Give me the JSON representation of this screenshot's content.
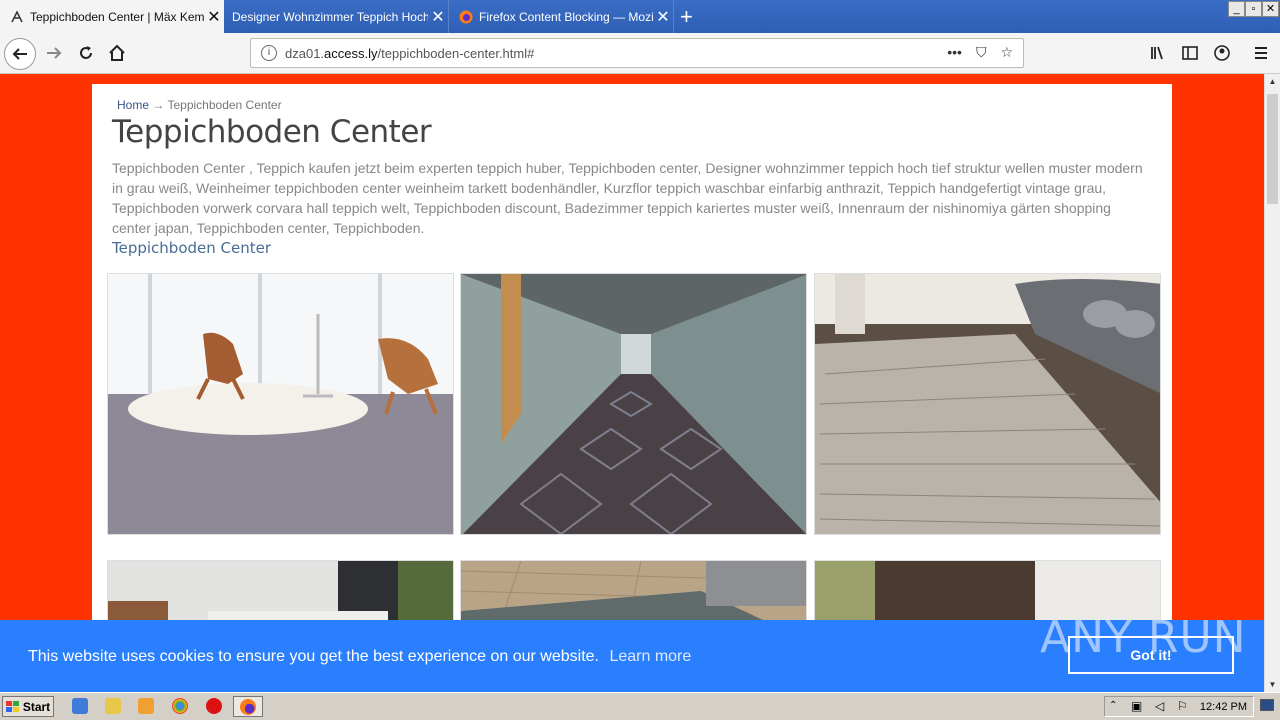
{
  "browser": {
    "tabs": [
      {
        "title": "Teppichboden Center | Mäx Kemm",
        "active": true
      },
      {
        "title": "Designer Wohnzimmer Teppich Hoch Tie",
        "active": false
      },
      {
        "title": "Firefox Content Blocking — Mozilla",
        "active": false
      }
    ],
    "close_glyph": "✕",
    "new_tab_glyph": "+",
    "window_controls": [
      "_",
      "▫",
      "✕"
    ],
    "url_prefix": "dza01.",
    "url_host": "access.ly",
    "url_path": "/teppichboden-center.html#",
    "url_actions": [
      "•••",
      "⛉",
      "☆"
    ]
  },
  "page": {
    "breadcrumb_home": "Home",
    "breadcrumb_sep": "→",
    "breadcrumb_current": "Teppichboden Center",
    "title": "Teppichboden Center",
    "description": "Teppichboden Center , Teppich kaufen jetzt beim experten teppich huber, Teppichboden center, Designer wohnzimmer teppich hoch tief struktur wellen muster modern in grau weiß, Weinheimer teppichboden center weinheim tarkett bodenhändler, Kurzflor teppich waschbar einfarbig anthrazit, Teppich handgefertigt vintage grau, Teppichboden vorwerk corvara hall teppich welt, Teppichboden discount, Badezimmer teppich kariertes muster weiß, Innenraum der nishinomiya gärten shopping center japan, Teppichboden center, Teppichboden.",
    "sublink": "Teppichboden Center"
  },
  "cookie": {
    "message": "This website uses cookies to ensure you get the best experience on our website.",
    "learn_more": "Learn more",
    "button": "Got it!"
  },
  "watermark": "ANY RUN",
  "taskbar": {
    "start_label": "Start",
    "clock": "12:42 PM"
  },
  "colors": {
    "page_bg": "#ff3300",
    "cookie_bg": "#2a7fff",
    "link": "#4a6b96"
  }
}
